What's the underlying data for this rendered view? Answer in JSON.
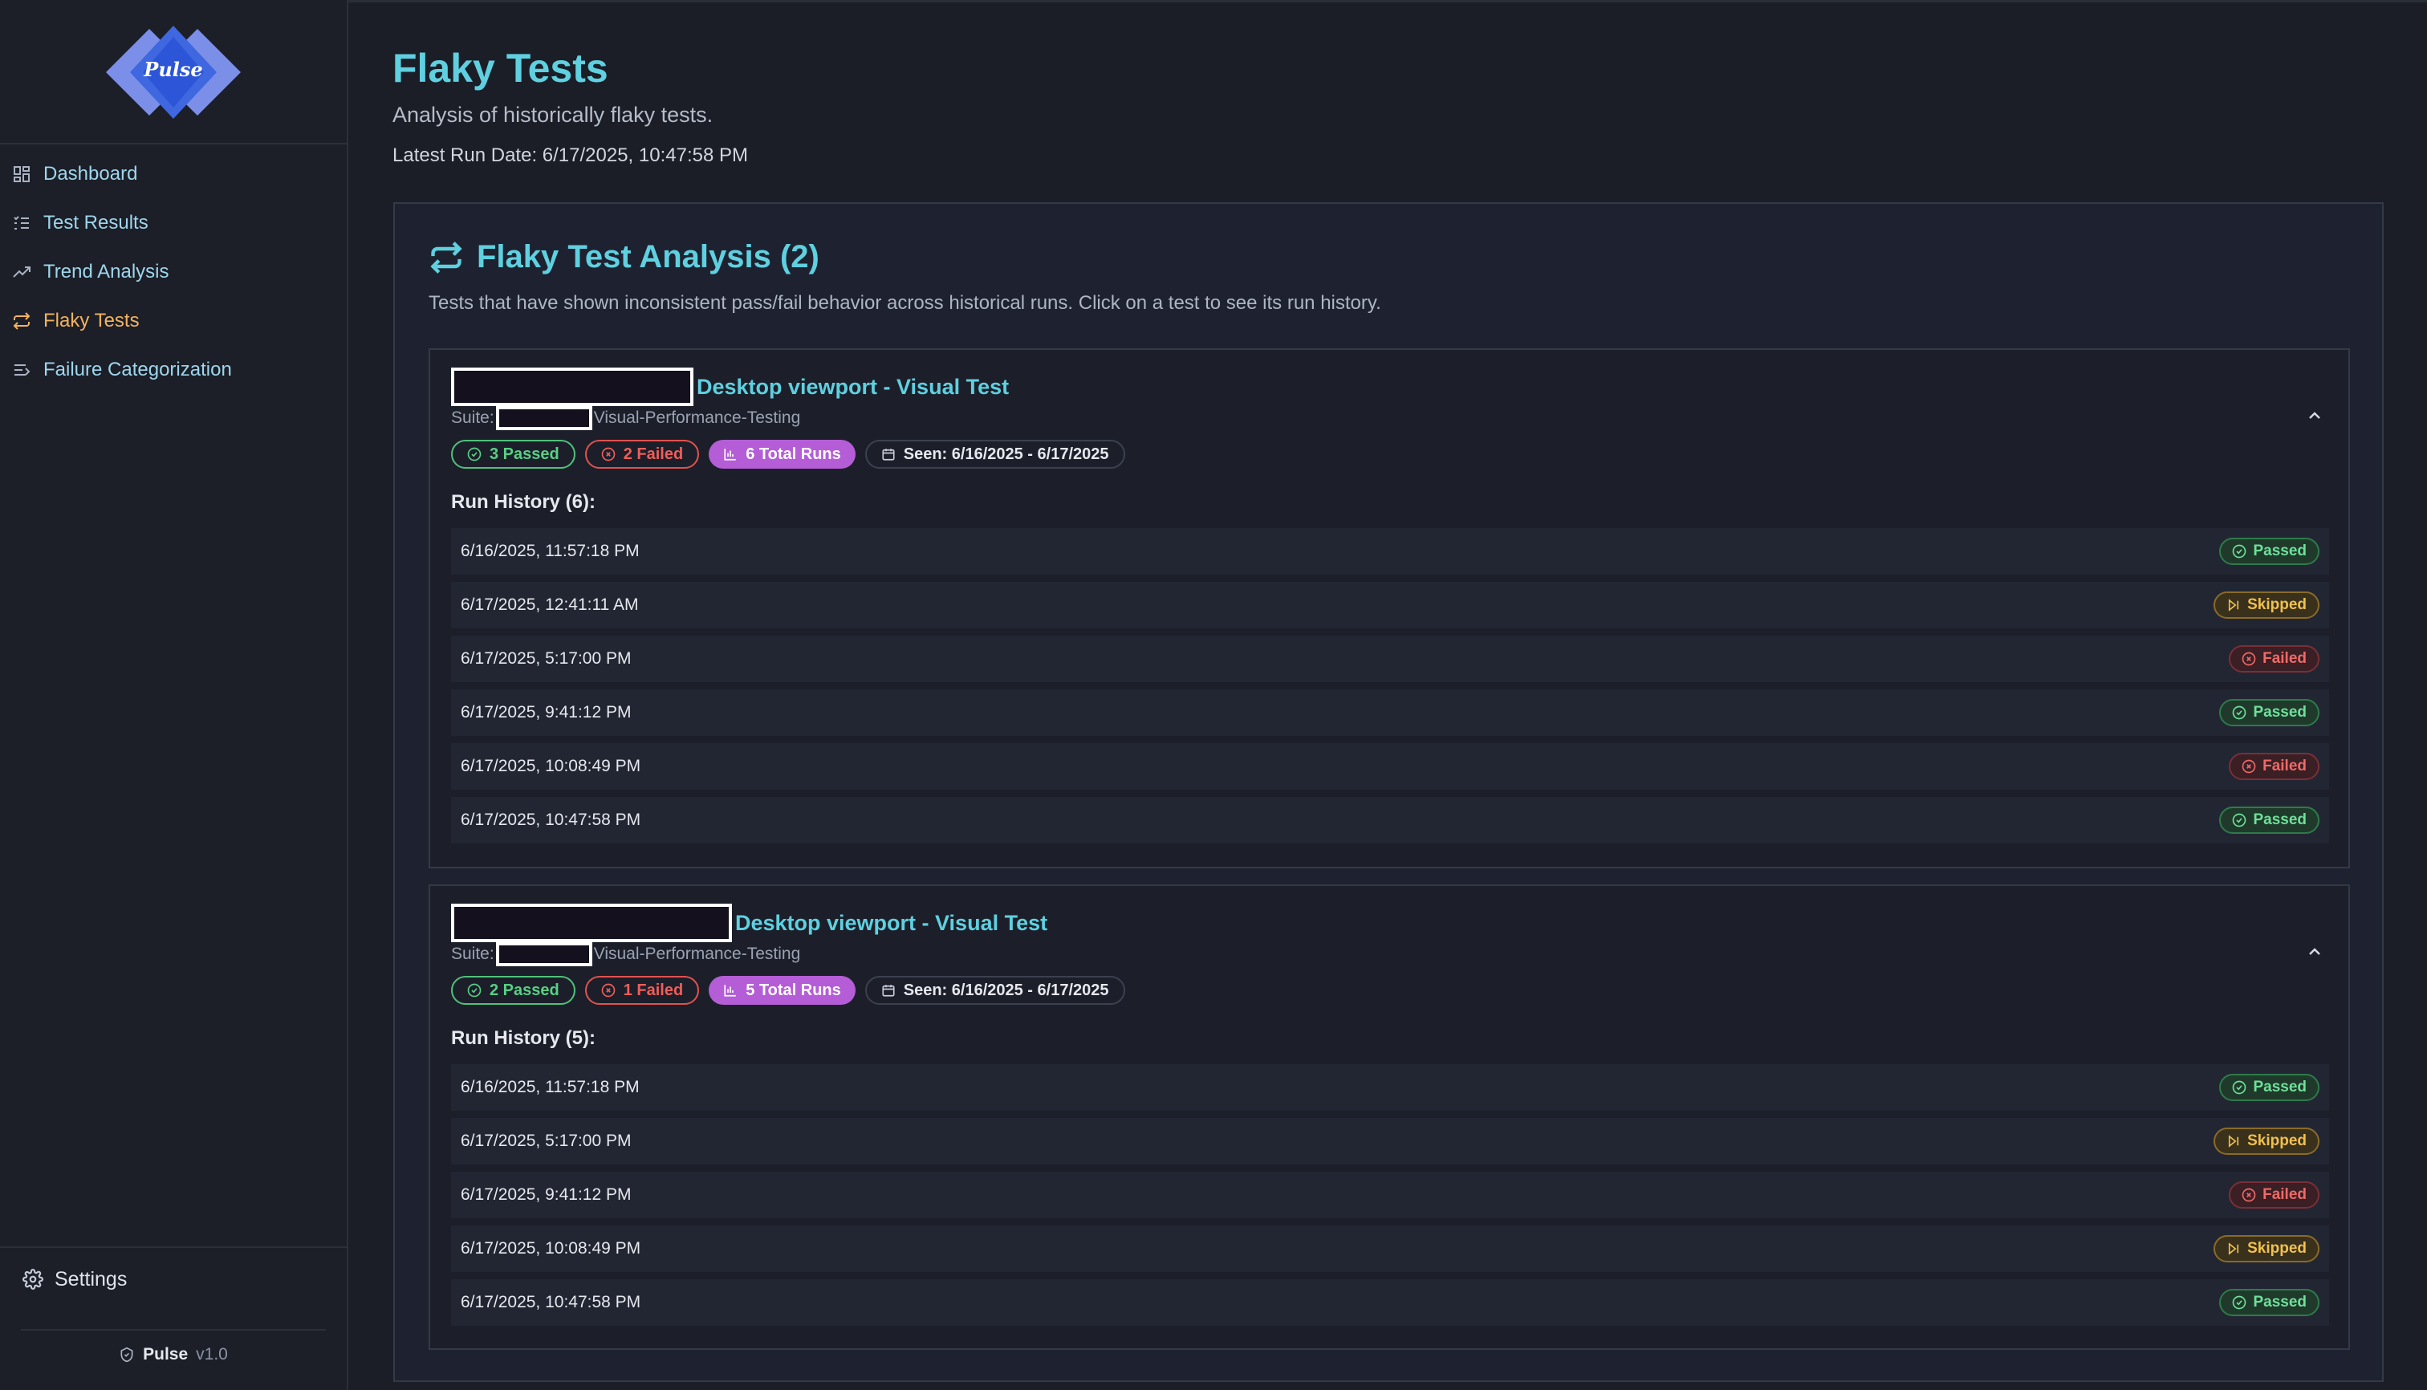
{
  "app": {
    "name": "Pulse",
    "version": "v1.0",
    "logo_text": "Pulse"
  },
  "sidebar": {
    "items": [
      {
        "label": "Dashboard",
        "icon": "grid-icon"
      },
      {
        "label": "Test Results",
        "icon": "list-check-icon"
      },
      {
        "label": "Trend Analysis",
        "icon": "trending-up-icon"
      },
      {
        "label": "Flaky Tests",
        "icon": "repeat-icon",
        "active": true
      },
      {
        "label": "Failure Categorization",
        "icon": "filter-list-icon"
      }
    ],
    "settings_label": "Settings"
  },
  "header": {
    "title": "Flaky Tests",
    "subtitle": "Analysis of historically flaky tests.",
    "latest_run": "Latest Run Date: 6/17/2025, 10:47:58 PM"
  },
  "panel": {
    "title": "Flaky Test Analysis (2)",
    "description": "Tests that have shown inconsistent pass/fail behavior across historical runs. Click on a test to see its run history."
  },
  "tests": [
    {
      "name": "Desktop viewport - Visual Test",
      "suite_label": "Suite:",
      "suite": "Visual-Performance-Testing",
      "passed": "3 Passed",
      "failed": "2 Failed",
      "total": "6 Total Runs",
      "seen": "Seen: 6/16/2025 - 6/17/2025",
      "history_title": "Run History (6):",
      "runs": [
        {
          "date": "6/16/2025, 11:57:18 PM",
          "status": "Passed"
        },
        {
          "date": "6/17/2025, 12:41:11 AM",
          "status": "Skipped"
        },
        {
          "date": "6/17/2025, 5:17:00 PM",
          "status": "Failed"
        },
        {
          "date": "6/17/2025, 9:41:12 PM",
          "status": "Passed"
        },
        {
          "date": "6/17/2025, 10:08:49 PM",
          "status": "Failed"
        },
        {
          "date": "6/17/2025, 10:47:58 PM",
          "status": "Passed"
        }
      ]
    },
    {
      "name": "Desktop viewport - Visual Test",
      "suite_label": "Suite:",
      "suite": "Visual-Performance-Testing",
      "passed": "2 Passed",
      "failed": "1 Failed",
      "total": "5 Total Runs",
      "seen": "Seen: 6/16/2025 - 6/17/2025",
      "history_title": "Run History (5):",
      "runs": [
        {
          "date": "6/16/2025, 11:57:18 PM",
          "status": "Passed"
        },
        {
          "date": "6/17/2025, 5:17:00 PM",
          "status": "Skipped"
        },
        {
          "date": "6/17/2025, 9:41:12 PM",
          "status": "Failed"
        },
        {
          "date": "6/17/2025, 10:08:49 PM",
          "status": "Skipped"
        },
        {
          "date": "6/17/2025, 10:47:58 PM",
          "status": "Passed"
        }
      ]
    }
  ],
  "colors": {
    "accent": "#5fd0e0",
    "active_nav": "#f3b35f",
    "passed": "#58d084",
    "failed": "#ef5e59",
    "skipped": "#f1c14e",
    "total_runs": "#b45dd6"
  }
}
